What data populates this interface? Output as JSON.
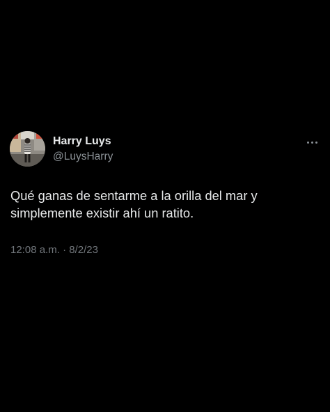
{
  "author": {
    "display_name": "Harry Luys",
    "handle": "@LuysHarry",
    "avatar_icon": "profile-photo"
  },
  "actions": {
    "more_icon": "more-horizontal-icon"
  },
  "tweet": {
    "text_lines": [
      "Qué ganas de sentarme a la orilla del mar y",
      "simplemente existir ahí un ratito."
    ],
    "time": "12:08 a.m.",
    "separator": "·",
    "date": "8/2/23"
  },
  "colors": {
    "background": "#000000",
    "primary_text": "#e7e9ea",
    "secondary_text": "#71767b"
  }
}
